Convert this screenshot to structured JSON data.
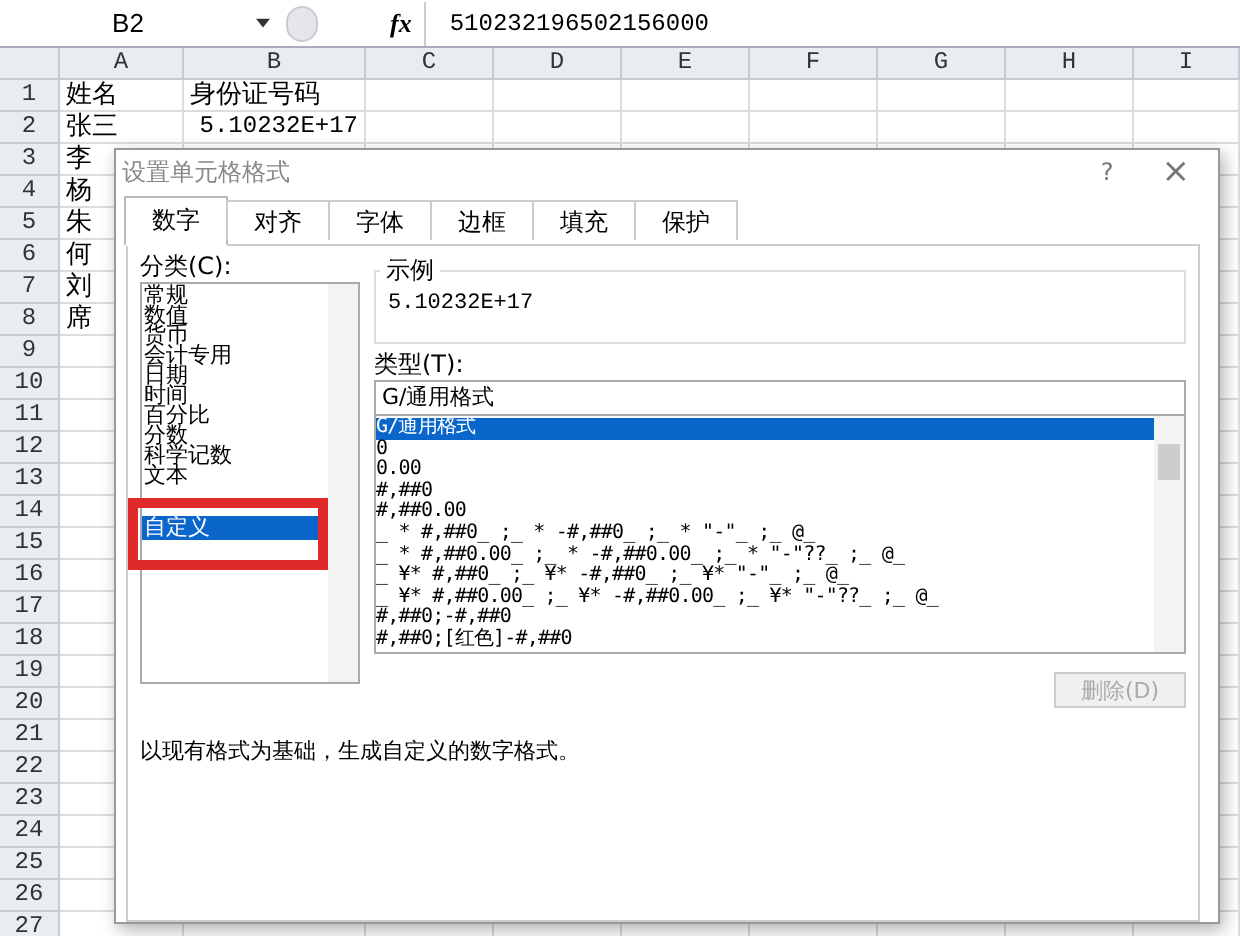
{
  "formula_bar": {
    "name_box": "B2",
    "fx": "fx",
    "value": "510232196502156000"
  },
  "sheet": {
    "columns": [
      "A",
      "B",
      "C",
      "D",
      "E",
      "F",
      "G",
      "H",
      "I"
    ],
    "row_numbers": [
      "1",
      "2",
      "3",
      "4",
      "5",
      "6",
      "7",
      "8",
      "9",
      "10",
      "11",
      "12",
      "13",
      "14",
      "15",
      "16",
      "17",
      "18",
      "19",
      "20",
      "21",
      "22",
      "23",
      "24",
      "25",
      "26",
      "27"
    ],
    "rows": [
      [
        {
          "text": "姓名",
          "kind": "text"
        },
        {
          "text": "身份证号码",
          "kind": "text"
        }
      ],
      [
        {
          "text": "张三",
          "kind": "text"
        },
        {
          "text": "5.10232E+17",
          "kind": "number"
        }
      ],
      [
        {
          "text": "李",
          "kind": "text"
        }
      ],
      [
        {
          "text": "杨",
          "kind": "text"
        }
      ],
      [
        {
          "text": "朱",
          "kind": "text"
        }
      ],
      [
        {
          "text": "何",
          "kind": "text"
        }
      ],
      [
        {
          "text": "刘",
          "kind": "text"
        }
      ],
      [
        {
          "text": "席",
          "kind": "text"
        }
      ]
    ]
  },
  "dialog": {
    "title": "设置单元格格式",
    "help": "?",
    "close": "×",
    "tabs": [
      {
        "label": "数字",
        "selected": true
      },
      {
        "label": "对齐",
        "selected": false
      },
      {
        "label": "字体",
        "selected": false
      },
      {
        "label": "边框",
        "selected": false
      },
      {
        "label": "填充",
        "selected": false
      },
      {
        "label": "保护",
        "selected": false
      }
    ],
    "category_label": "分类(C):",
    "categories": [
      {
        "label": "常规",
        "selected": false
      },
      {
        "label": "数值",
        "selected": false
      },
      {
        "label": "货币",
        "selected": false
      },
      {
        "label": "会计专用",
        "selected": false
      },
      {
        "label": "日期",
        "selected": false
      },
      {
        "label": "时间",
        "selected": false
      },
      {
        "label": "百分比",
        "selected": false
      },
      {
        "label": "分数",
        "selected": false
      },
      {
        "label": "科学记数",
        "selected": false
      },
      {
        "label": "文本",
        "selected": false
      },
      {
        "label": "自定义",
        "selected": true
      }
    ],
    "sample_label": "示例",
    "sample_value": "5.10232E+17",
    "type_label": "类型(T):",
    "type_input": "G/通用格式",
    "types": [
      {
        "label": "G/通用格式",
        "selected": true
      },
      {
        "label": "0",
        "selected": false
      },
      {
        "label": "0.00",
        "selected": false
      },
      {
        "label": "#,##0",
        "selected": false
      },
      {
        "label": "#,##0.00",
        "selected": false
      },
      {
        "label": "_ * #,##0_ ;_ * -#,##0_ ;_ * \"-\"_ ;_ @_ ",
        "selected": false
      },
      {
        "label": "_ * #,##0.00_ ;_ * -#,##0.00_ ;_ * \"-\"??_ ;_ @_ ",
        "selected": false
      },
      {
        "label": "_ ¥* #,##0_ ;_ ¥* -#,##0_ ;_ ¥* \"-\"_ ;_ @_ ",
        "selected": false
      },
      {
        "label": "_ ¥* #,##0.00_ ;_ ¥* -#,##0.00_ ;_ ¥* \"-\"??_ ;_ @_ ",
        "selected": false
      },
      {
        "label": "#,##0;-#,##0",
        "selected": false
      },
      {
        "label": "#,##0;[红色]-#,##0",
        "selected": false
      }
    ],
    "delete_button": {
      "label": "删除(D)",
      "disabled": true
    },
    "description": "以现有格式为基础，生成自定义的数字格式。"
  }
}
